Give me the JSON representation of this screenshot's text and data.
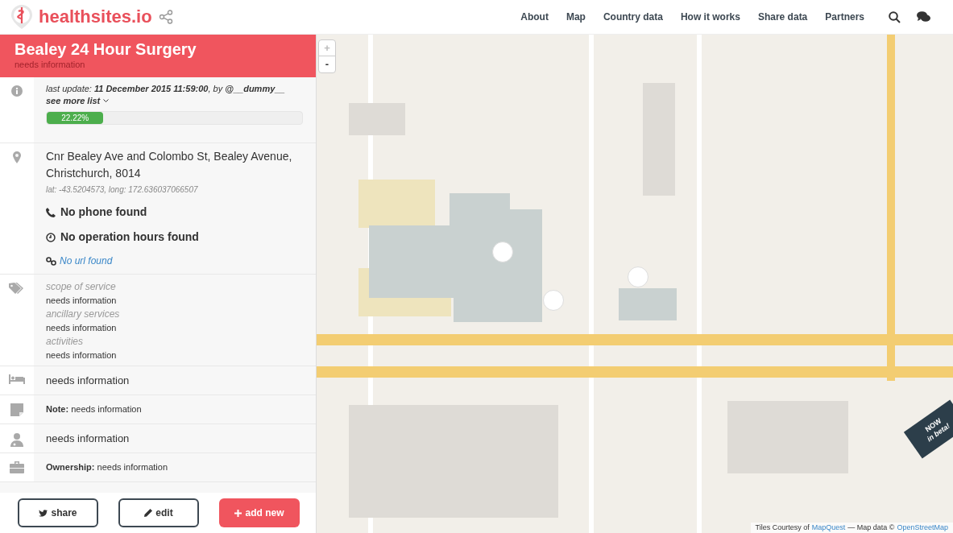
{
  "brand": {
    "name": "healthsites.io"
  },
  "nav": [
    "About",
    "Map",
    "Country data",
    "How it works",
    "Share data",
    "Partners"
  ],
  "facility": {
    "name": "Bealey 24 Hour Surgery",
    "subtitle": "needs information"
  },
  "update": {
    "text": "last update: **11 December 2015 11:59:00**, by **@__dummy__**",
    "see_more": "see more list",
    "level": 0.2222,
    "reading": "22.22%"
  },
  "location": {
    "address": "Cnr Bealey Ave and Colombo St, Bealey Avenue, Christchurch, 8014",
    "coords": "lat: -43.5204573, long: 172.636037066507",
    "phone": "No phone found",
    "hours": "No operation hours found",
    "url": "No url found"
  },
  "services": [
    {
      "label": "scope of service",
      "value": "needs information"
    },
    {
      "label": "ancillary services",
      "value": "needs information"
    },
    {
      "label": "activities",
      "value": "needs information"
    }
  ],
  "rows": [
    {
      "kind": "bed",
      "text": "needs information"
    },
    {
      "kind": "note",
      "text": "**Note:** needs information"
    },
    {
      "kind": "staff",
      "text": "needs information"
    },
    {
      "kind": "ownership",
      "text": "**Ownership:** needs information"
    }
  ],
  "actions": [
    {
      "kind": "share",
      "label": "share"
    },
    {
      "kind": "edit",
      "label": "edit"
    },
    {
      "kind": "add",
      "label": "add new"
    }
  ],
  "map": {
    "kind": "picture",
    "zoom": [
      "+",
      "-"
    ],
    "attribution": {
      "prefix": "Tiles Courtesy of",
      "link1": "MapQuest",
      "middle": "— Map data ©",
      "link2": "OpenStreetMap"
    },
    "ribbon": [
      "NOW",
      "in beta!"
    ]
  }
}
